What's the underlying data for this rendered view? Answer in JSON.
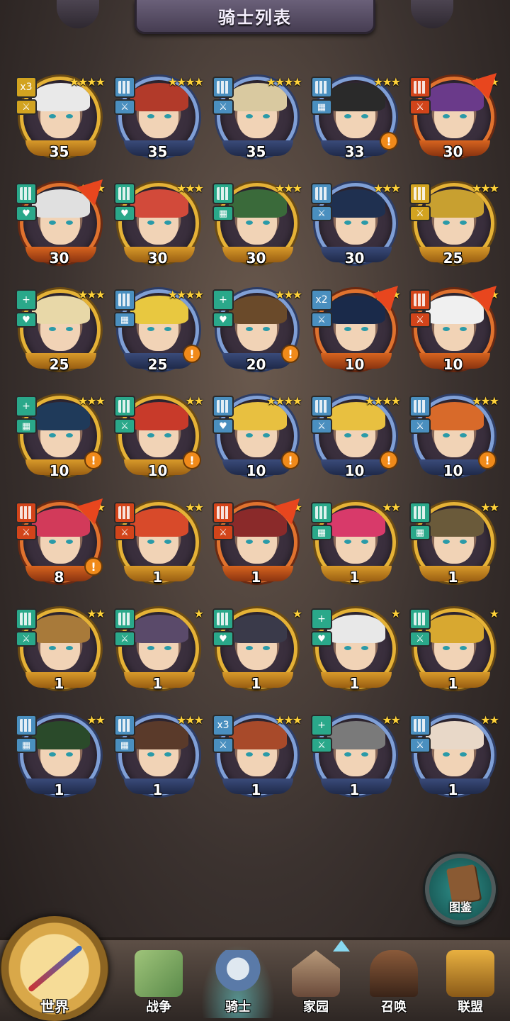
{
  "header": {
    "title": "骑士列表"
  },
  "colors": {
    "gold": "#e5b236",
    "blue": "#7f9fd6",
    "red": "#e0722e",
    "accent_teal": "#2e8f8a"
  },
  "knights": [
    [
      {
        "level": "35",
        "stars": "★★★★",
        "frame": "gold",
        "badge": "x3",
        "badgeColor": "#d2a320",
        "role": "sword",
        "alert": false,
        "arrow": false,
        "hair": "#e9e9e9"
      },
      {
        "level": "35",
        "stars": "★★★★",
        "frame": "blue",
        "badge": "",
        "badgeColor": "#4a8fbf",
        "role": "sword",
        "alert": false,
        "arrow": false,
        "hair": "#b23a2a"
      },
      {
        "level": "35",
        "stars": "★★★★",
        "frame": "blue",
        "badge": "",
        "badgeColor": "#4a8fbf",
        "role": "sword",
        "alert": false,
        "arrow": false,
        "hair": "#d9c9a0"
      },
      {
        "level": "33",
        "stars": "★★★",
        "frame": "blue",
        "badge": "",
        "badgeColor": "#4a8fbf",
        "role": "grid",
        "alert": true,
        "arrow": false,
        "hair": "#2a2a2a"
      },
      {
        "level": "30",
        "stars": "★★★",
        "frame": "red",
        "badge": "",
        "badgeColor": "#d2441a",
        "role": "sword",
        "alert": false,
        "arrow": true,
        "hair": "#6a3a8a"
      }
    ],
    [
      {
        "level": "30",
        "stars": "★★★",
        "frame": "red",
        "badge": "",
        "badgeColor": "#2aa88a",
        "role": "heart",
        "alert": false,
        "arrow": true,
        "hair": "#e0e0e0"
      },
      {
        "level": "30",
        "stars": "★★★",
        "frame": "gold",
        "badge": "",
        "badgeColor": "#2aa88a",
        "role": "heart",
        "alert": false,
        "arrow": false,
        "hair": "#d24a3a"
      },
      {
        "level": "30",
        "stars": "★★★",
        "frame": "gold",
        "badge": "",
        "badgeColor": "#2aa88a",
        "role": "grid",
        "alert": false,
        "arrow": false,
        "hair": "#3a6a3a"
      },
      {
        "level": "30",
        "stars": "★★★",
        "frame": "blue",
        "badge": "",
        "badgeColor": "#4a8fbf",
        "role": "sword",
        "alert": false,
        "arrow": false,
        "hair": "#1f3050"
      },
      {
        "level": "25",
        "stars": "★★★",
        "frame": "gold",
        "badge": "",
        "badgeColor": "#d2a320",
        "role": "sword",
        "alert": false,
        "arrow": false,
        "hair": "#c8a030"
      }
    ],
    [
      {
        "level": "25",
        "stars": "★★★",
        "frame": "gold",
        "badge": "+",
        "badgeColor": "#2aa88a",
        "role": "heart",
        "alert": false,
        "arrow": false,
        "hair": "#e8d8a8"
      },
      {
        "level": "25",
        "stars": "★★★★",
        "frame": "blue",
        "badge": "",
        "badgeColor": "#4a8fbf",
        "role": "grid",
        "alert": true,
        "arrow": false,
        "hair": "#e8c840"
      },
      {
        "level": "20",
        "stars": "★★★",
        "frame": "blue",
        "badge": "+",
        "badgeColor": "#2aa88a",
        "role": "heart",
        "alert": true,
        "arrow": false,
        "hair": "#6a4a2a"
      },
      {
        "level": "10",
        "stars": "★★★",
        "frame": "red",
        "badge": "x2",
        "badgeColor": "#4a8fbf",
        "role": "sword",
        "alert": false,
        "arrow": true,
        "hair": "#1a2a4a"
      },
      {
        "level": "10",
        "stars": "★",
        "frame": "red",
        "badge": "",
        "badgeColor": "#d2441a",
        "role": "sword",
        "alert": false,
        "arrow": true,
        "hair": "#f0f0f0"
      }
    ],
    [
      {
        "level": "10",
        "stars": "★★★",
        "frame": "gold",
        "badge": "+",
        "badgeColor": "#2aa88a",
        "role": "grid",
        "alert": true,
        "arrow": false,
        "hair": "#1f3a5a"
      },
      {
        "level": "10",
        "stars": "★★",
        "frame": "gold",
        "badge": "",
        "badgeColor": "#2aa88a",
        "role": "sword",
        "alert": true,
        "arrow": false,
        "hair": "#c83a2a"
      },
      {
        "level": "10",
        "stars": "★★★★",
        "frame": "blue",
        "badge": "",
        "badgeColor": "#4a8fbf",
        "role": "heart",
        "alert": true,
        "arrow": false,
        "hair": "#e8c040"
      },
      {
        "level": "10",
        "stars": "★★★★",
        "frame": "blue",
        "badge": "",
        "badgeColor": "#4a8fbf",
        "role": "sword",
        "alert": true,
        "arrow": false,
        "hair": "#e8c040"
      },
      {
        "level": "10",
        "stars": "★★★",
        "frame": "blue",
        "badge": "",
        "badgeColor": "#4a8fbf",
        "role": "sword",
        "alert": true,
        "arrow": false,
        "hair": "#d86a2a"
      }
    ],
    [
      {
        "level": "8",
        "stars": "★",
        "frame": "red",
        "badge": "",
        "badgeColor": "#d2441a",
        "role": "sword",
        "alert": true,
        "arrow": true,
        "hair": "#d23a5a"
      },
      {
        "level": "1",
        "stars": "★★",
        "frame": "gold",
        "badge": "",
        "badgeColor": "#d2441a",
        "role": "sword",
        "alert": false,
        "arrow": false,
        "hair": "#d84a2a"
      },
      {
        "level": "1",
        "stars": "★★",
        "frame": "red",
        "badge": "",
        "badgeColor": "#d2441a",
        "role": "sword",
        "alert": false,
        "arrow": true,
        "hair": "#8a2a2a"
      },
      {
        "level": "1",
        "stars": "★★",
        "frame": "gold",
        "badge": "",
        "badgeColor": "#2aa88a",
        "role": "grid",
        "alert": false,
        "arrow": false,
        "hair": "#d83a6a"
      },
      {
        "level": "1",
        "stars": "★★",
        "frame": "gold",
        "badge": "",
        "badgeColor": "#2aa88a",
        "role": "grid",
        "alert": false,
        "arrow": false,
        "hair": "#6a5a3a"
      }
    ],
    [
      {
        "level": "1",
        "stars": "★★",
        "frame": "gold",
        "badge": "",
        "badgeColor": "#2aa88a",
        "role": "sword",
        "alert": false,
        "arrow": false,
        "hair": "#a87a3a"
      },
      {
        "level": "1",
        "stars": "★",
        "frame": "gold",
        "badge": "",
        "badgeColor": "#2aa88a",
        "role": "sword",
        "alert": false,
        "arrow": false,
        "hair": "#5a4a6a"
      },
      {
        "level": "1",
        "stars": "★",
        "frame": "gold",
        "badge": "",
        "badgeColor": "#2aa88a",
        "role": "heart",
        "alert": false,
        "arrow": false,
        "hair": "#3a3a4a"
      },
      {
        "level": "1",
        "stars": "★",
        "frame": "gold",
        "badge": "+",
        "badgeColor": "#2aa88a",
        "role": "heart",
        "alert": false,
        "arrow": false,
        "hair": "#e8e8e8"
      },
      {
        "level": "1",
        "stars": "★",
        "frame": "gold",
        "badge": "",
        "badgeColor": "#2aa88a",
        "role": "sword",
        "alert": false,
        "arrow": false,
        "hair": "#d8a830"
      }
    ],
    [
      {
        "level": "1",
        "stars": "★★",
        "frame": "blue",
        "badge": "",
        "badgeColor": "#4a8fbf",
        "role": "grid",
        "alert": false,
        "arrow": false,
        "hair": "#2a4a2a"
      },
      {
        "level": "1",
        "stars": "★★★",
        "frame": "blue",
        "badge": "",
        "badgeColor": "#4a8fbf",
        "role": "grid",
        "alert": false,
        "arrow": false,
        "hair": "#5a3a2a"
      },
      {
        "level": "1",
        "stars": "★★★",
        "frame": "blue",
        "badge": "x3",
        "badgeColor": "#4a8fbf",
        "role": "sword",
        "alert": false,
        "arrow": false,
        "hair": "#a84a2a"
      },
      {
        "level": "1",
        "stars": "★★",
        "frame": "blue",
        "badge": "+",
        "badgeColor": "#2aa88a",
        "role": "sword",
        "alert": false,
        "arrow": false,
        "hair": "#7a7a7a"
      },
      {
        "level": "1",
        "stars": "★★",
        "frame": "blue",
        "badge": "",
        "badgeColor": "#4a8fbf",
        "role": "sword",
        "alert": false,
        "arrow": false,
        "hair": "#e8d8c8"
      }
    ]
  ],
  "codex": {
    "label": "图鉴"
  },
  "nav": {
    "world": "世界",
    "war": "战争",
    "knight": "骑士",
    "home": "家园",
    "summon": "召唤",
    "alliance": "联盟"
  }
}
